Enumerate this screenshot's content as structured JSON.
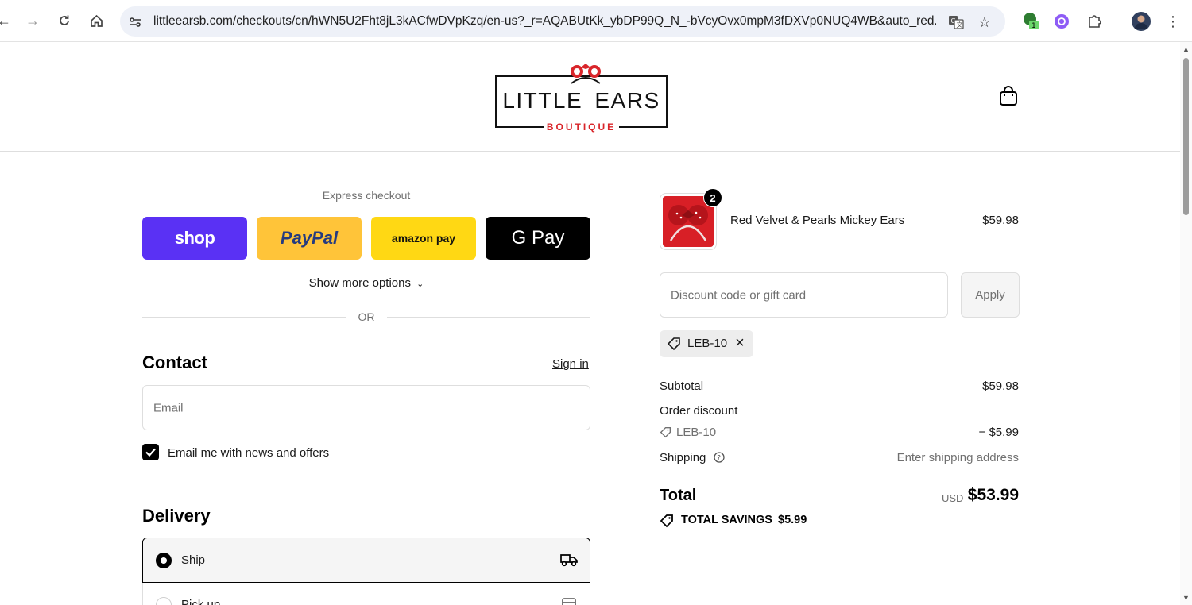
{
  "browser": {
    "url": "littleearsb.com/checkouts/cn/hWN5U2Fht8jL3kACfwDVpKzq/en-us?_r=AQABUtKk_ybDP99Q_N_-bVcyOvx0mpM3fDXVp0NUQ4WB&auto_red...",
    "extension_badge": "1"
  },
  "header": {
    "logo_main": "LITTLE EARS",
    "logo_sub": "BOUTIQUE"
  },
  "express": {
    "label": "Express checkout",
    "buttons": [
      "shop",
      "PayPal",
      "amazon pay",
      "G Pay"
    ],
    "show_more": "Show more options",
    "or": "OR"
  },
  "contact": {
    "title": "Contact",
    "sign_in": "Sign in",
    "email_placeholder": "Email",
    "newsletter_label": "Email me with news and offers",
    "newsletter_checked": true
  },
  "delivery": {
    "title": "Delivery",
    "options": [
      {
        "label": "Ship",
        "selected": true
      },
      {
        "label": "Pick up",
        "selected": false
      }
    ]
  },
  "summary": {
    "product": {
      "name": "Red Velvet & Pearls Mickey Ears",
      "price": "$59.98",
      "quantity": "2"
    },
    "discount_placeholder": "Discount code or gift card",
    "apply_label": "Apply",
    "applied_code": "LEB-10",
    "subtotal_label": "Subtotal",
    "subtotal_value": "$59.98",
    "order_discount_label": "Order discount",
    "discount_code": "LEB-10",
    "discount_value": "− $5.99",
    "shipping_label": "Shipping",
    "shipping_value": "Enter shipping address",
    "total_label": "Total",
    "currency": "USD",
    "total_value": "$53.99",
    "savings_label": "TOTAL SAVINGS",
    "savings_value": "$5.99"
  },
  "colors": {
    "shop": "#5a31f4",
    "paypal": "#ffc439",
    "amazon": "#ffd814",
    "gpay": "#000000",
    "brand_red": "#d9252a"
  }
}
